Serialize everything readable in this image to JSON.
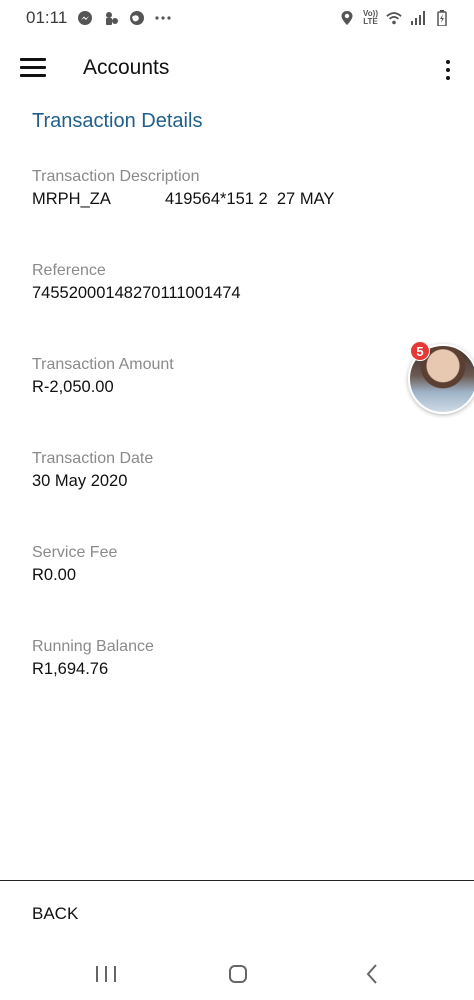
{
  "status_bar": {
    "time": "01:11",
    "volte_line1": "Vo))",
    "volte_line2": "LTE"
  },
  "app_bar": {
    "title": "Accounts"
  },
  "details": {
    "heading": "Transaction Details",
    "fields": [
      {
        "label": "Transaction Description",
        "value": "MRPH_ZA            419564*151 2  27 MAY"
      },
      {
        "label": "Reference",
        "value": "74552000148270111001474"
      },
      {
        "label": "Transaction Amount",
        "value": "R-2,050.00"
      },
      {
        "label": "Transaction Date",
        "value": "30 May 2020"
      },
      {
        "label": "Service Fee",
        "value": "R0.00"
      },
      {
        "label": "Running Balance",
        "value": "R1,694.76"
      }
    ]
  },
  "chat_head": {
    "badge_count": "5"
  },
  "footer": {
    "back_label": "BACK"
  },
  "colors": {
    "heading": "#1f5f8b",
    "label": "#8a8a8a",
    "badge": "#e53935"
  }
}
